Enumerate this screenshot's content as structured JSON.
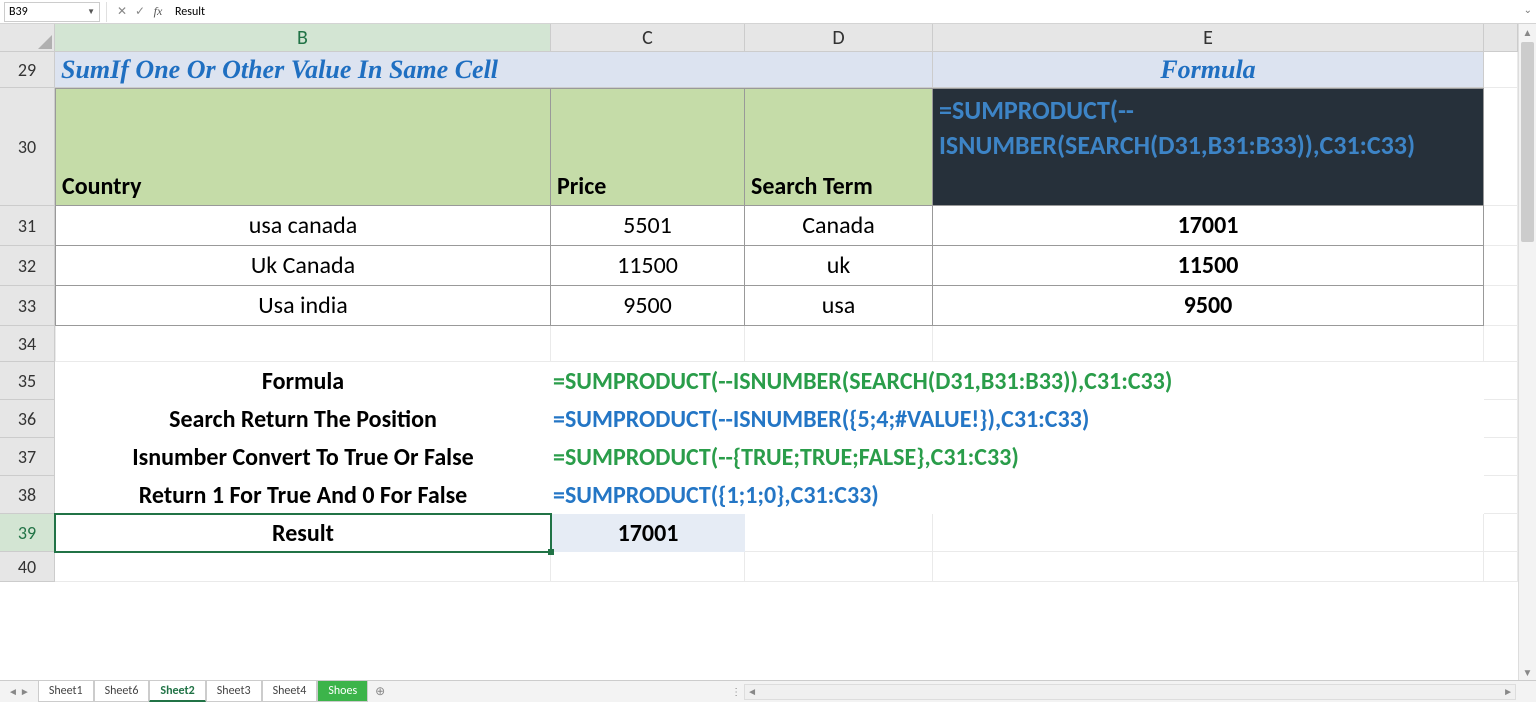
{
  "nameBox": "B39",
  "formulaBarValue": "Result",
  "columns": [
    "B",
    "C",
    "D",
    "E"
  ],
  "rows": [
    "29",
    "30",
    "31",
    "32",
    "33",
    "34",
    "35",
    "36",
    "37",
    "38",
    "39",
    "40"
  ],
  "activeColumn": "B",
  "activeRow": "39",
  "titleLeft": "SumIf One Or Other Value In Same Cell",
  "titleRight": "Formula",
  "headers": {
    "b": "Country",
    "c": "Price",
    "d": "Search Term",
    "e": "=SUMPRODUCT(--ISNUMBER(SEARCH(D31,B31:B33)),C31:C33)"
  },
  "data": [
    {
      "b": "usa canada",
      "c": "5501",
      "d": "Canada",
      "e": "17001"
    },
    {
      "b": "Uk Canada",
      "c": "11500",
      "d": "uk",
      "e": "11500"
    },
    {
      "b": "Usa india",
      "c": "9500",
      "d": "usa",
      "e": "9500"
    }
  ],
  "expl": {
    "r35_label": "Formula",
    "r35_val": "=SUMPRODUCT(--ISNUMBER(SEARCH(D31,B31:B33)),C31:C33)",
    "r36_label": "Search Return The Position",
    "r36_val": "=SUMPRODUCT(--ISNUMBER({5;4;#VALUE!}),C31:C33)",
    "r37_label": "Isnumber Convert To True Or False",
    "r37_val": "=SUMPRODUCT(--{TRUE;TRUE;FALSE},C31:C33)",
    "r38_label": "Return 1 For True And 0 For False",
    "r38_val": "=SUMPRODUCT({1;1;0},C31:C33)",
    "r39_label": "Result",
    "r39_val": "17001"
  },
  "tabs": [
    "Sheet1",
    "Sheet6",
    "Sheet2",
    "Sheet3",
    "Sheet4",
    "Shoes"
  ],
  "activeTab": "Sheet2",
  "colorTab": "Shoes",
  "icons": {
    "cancel": "✕",
    "enter": "✓",
    "fx": "fx",
    "dropdown": "▼",
    "expand": "⌄",
    "plus": "⊕"
  }
}
